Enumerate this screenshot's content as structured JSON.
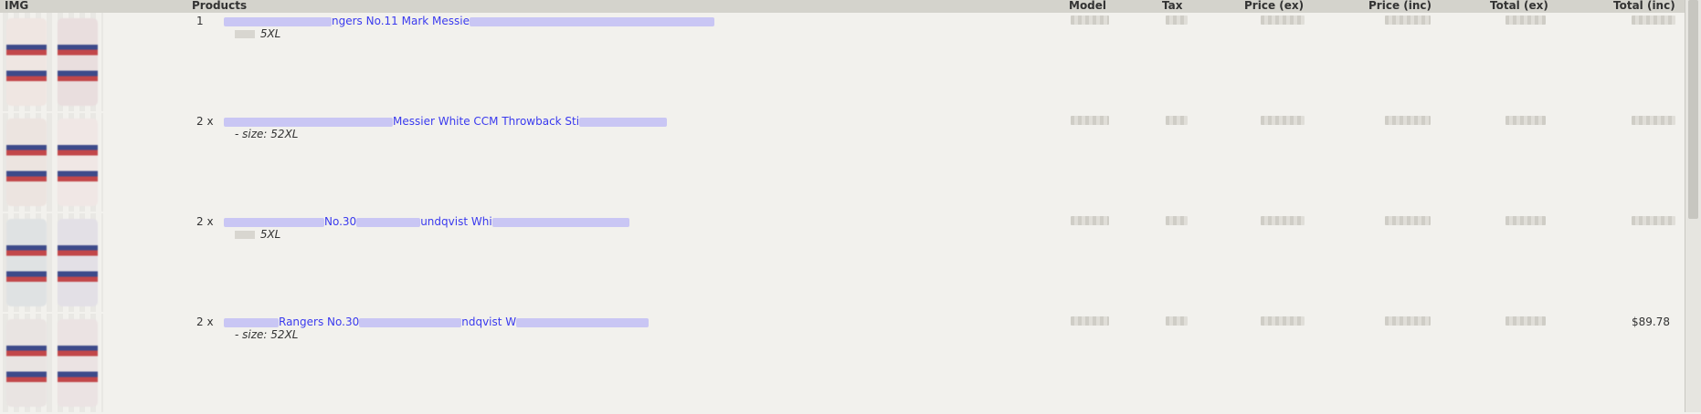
{
  "table": {
    "headers": {
      "img": "IMG",
      "products": "Products",
      "model": "Model",
      "tax": "Tax",
      "price_ex": "Price (ex)",
      "price_inc": "Price (inc)",
      "total_ex": "Total (ex)",
      "total_inc": "Total (inc)"
    },
    "rows": [
      {
        "qty": "1",
        "name_visible": "ngers No.11 Mark Messie",
        "attr_label": "",
        "attr_value": "5XL",
        "total_inc_visible": ""
      },
      {
        "qty": "2 x",
        "name_visible": "Messier White CCM Throwback Sti",
        "attr_label": "- size:",
        "attr_value": "52XL",
        "total_inc_visible": ""
      },
      {
        "qty": "2 x",
        "name_visible": "No.30",
        "name_visible_2": "undqvist Whi",
        "attr_label": "",
        "attr_value": "5XL",
        "total_inc_visible": ""
      },
      {
        "qty": "2 x",
        "name_visible": "Rangers No.30",
        "name_visible_2": "ndqvist W",
        "attr_label": "- size:",
        "attr_value": "52XL",
        "total_inc_visible": "$89.78"
      }
    ]
  },
  "colors": {
    "background": "#f2f1ed",
    "header_bg": "#d4d3cc",
    "link": "#3a3aee"
  }
}
